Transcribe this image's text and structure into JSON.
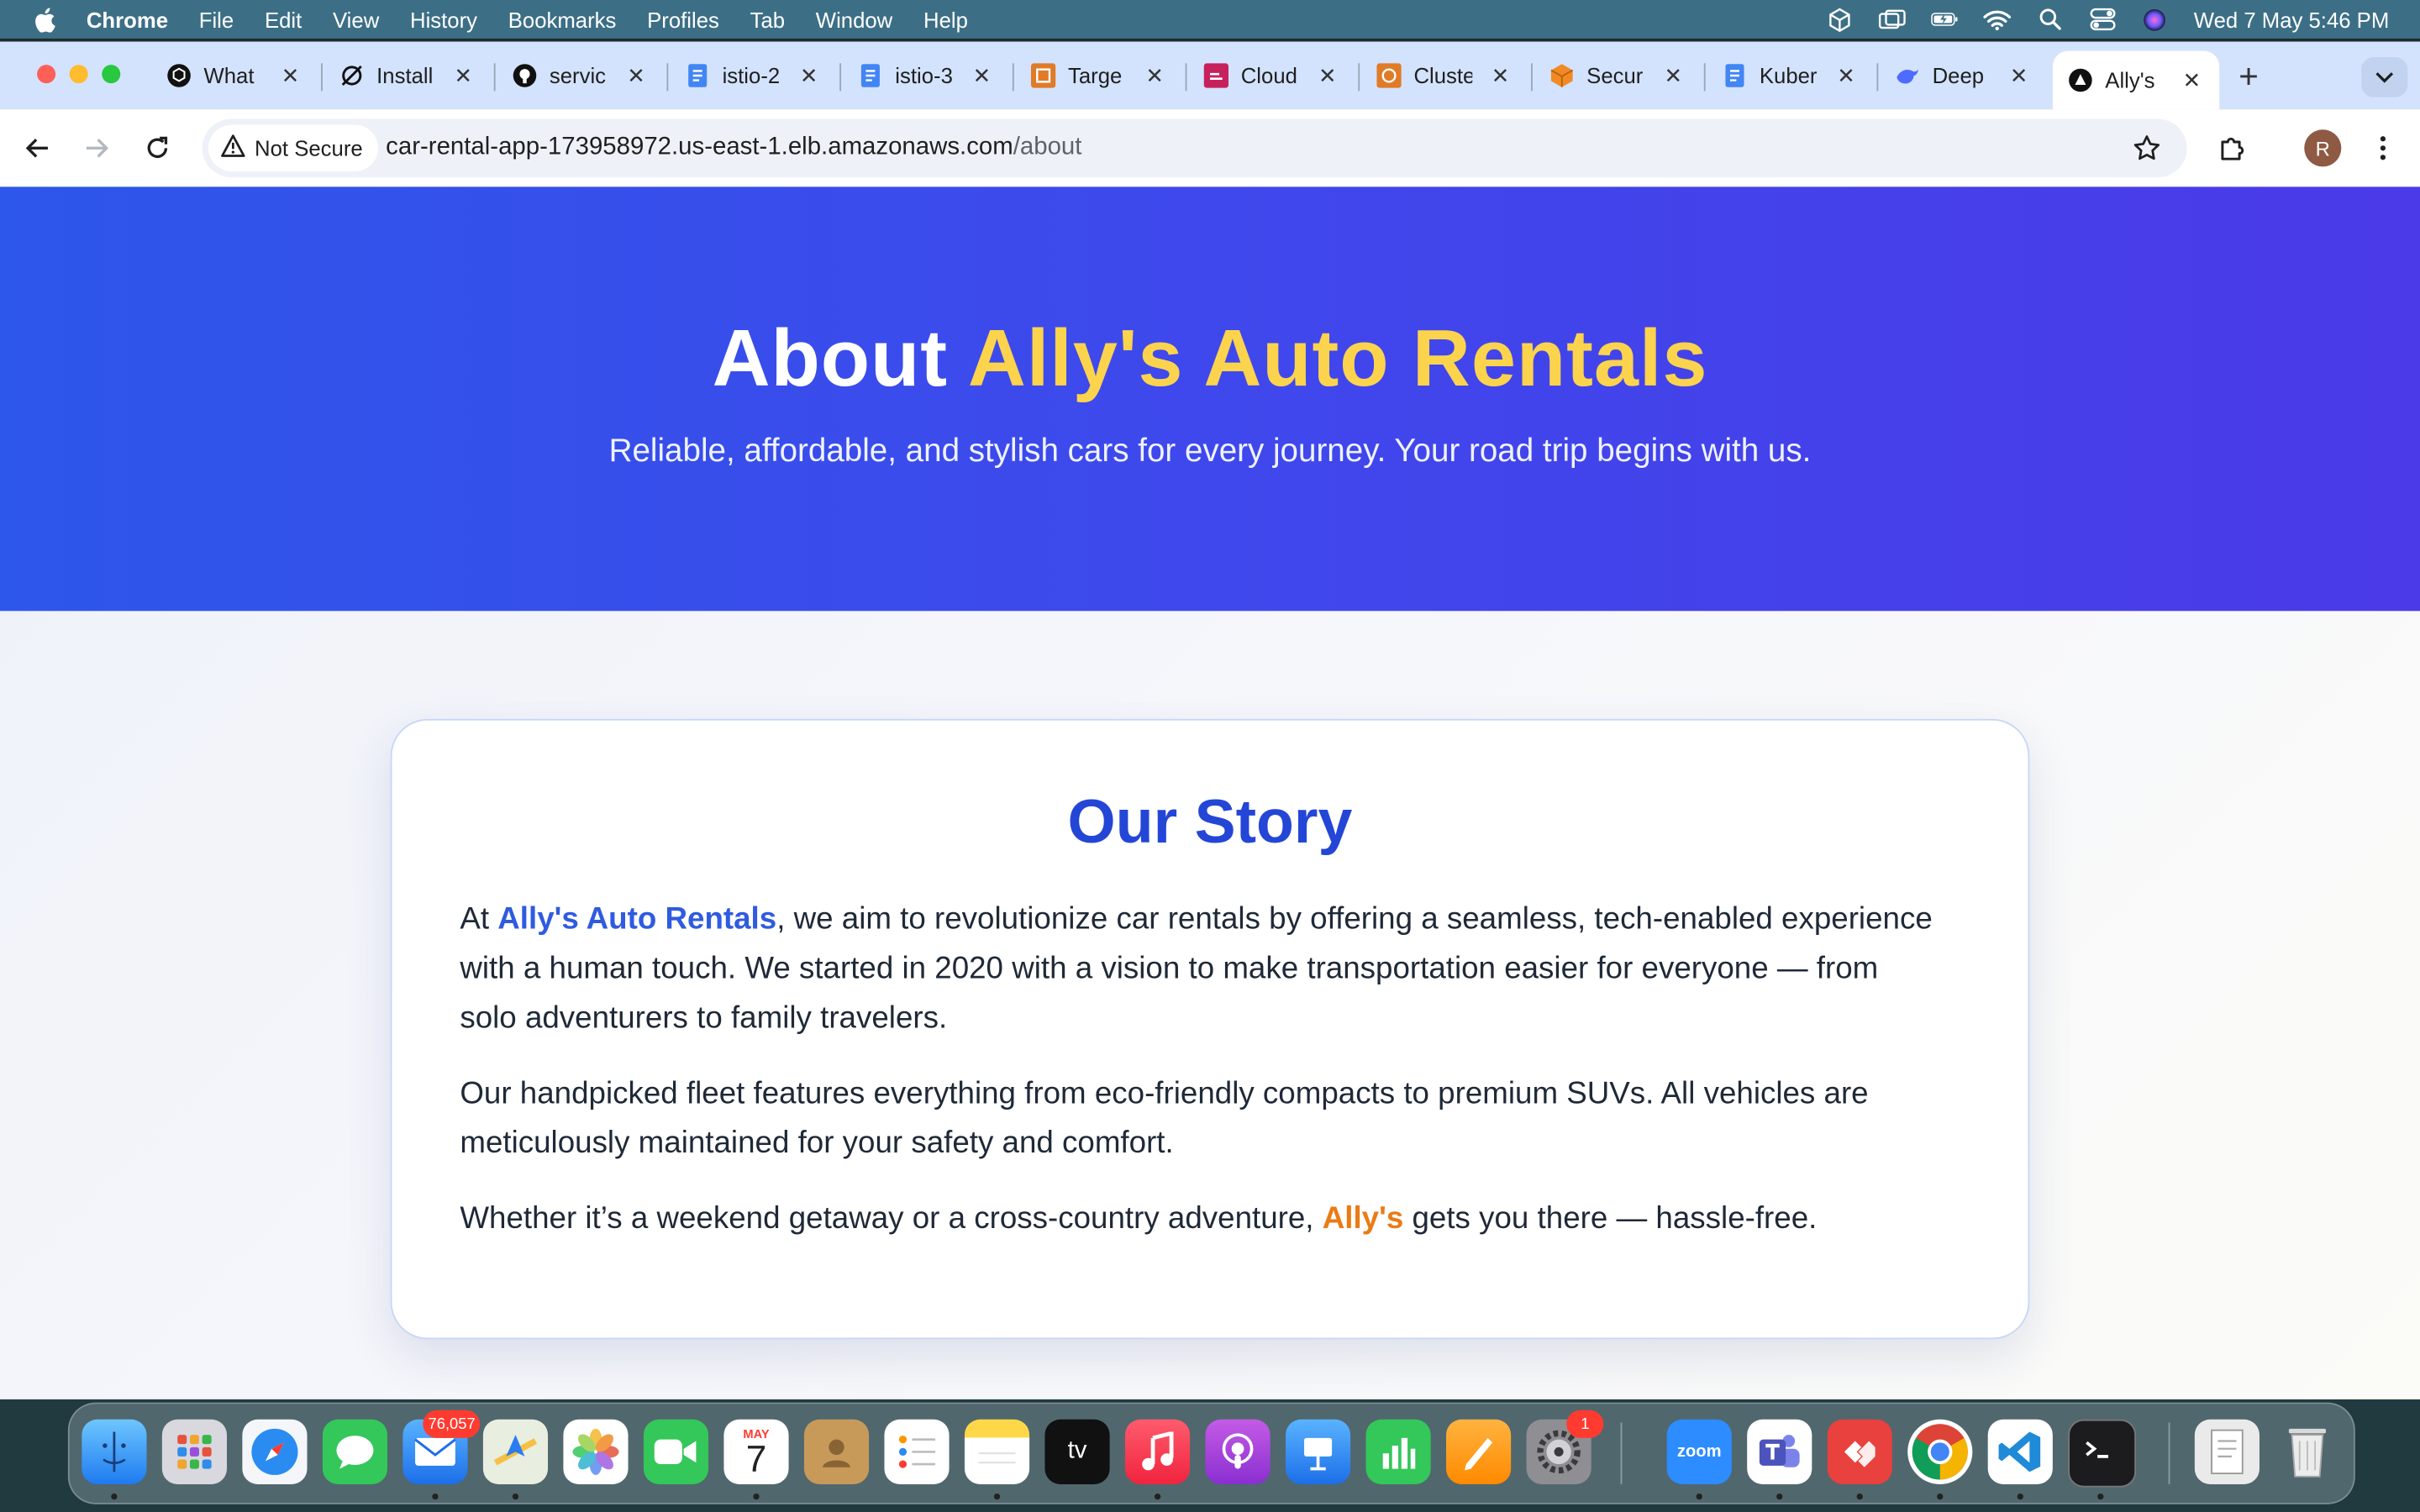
{
  "menubar": {
    "app_name": "Chrome",
    "menus": [
      "File",
      "Edit",
      "View",
      "History",
      "Bookmarks",
      "Profiles",
      "Tab",
      "Window",
      "Help"
    ],
    "clock": "Wed 7 May  5:46 PM"
  },
  "tabs": [
    {
      "title": "What",
      "icon": "openai-icon"
    },
    {
      "title": "Install",
      "icon": "link-icon"
    },
    {
      "title": "servic",
      "icon": "github-icon"
    },
    {
      "title": "istio-2",
      "icon": "docs-icon"
    },
    {
      "title": "istio-3",
      "icon": "docs-icon"
    },
    {
      "title": "Targe",
      "icon": "aws-icon"
    },
    {
      "title": "Cloud",
      "icon": "aws-cloud-icon"
    },
    {
      "title": "Cluste",
      "icon": "aws-icon"
    },
    {
      "title": "Secur",
      "icon": "cube-icon"
    },
    {
      "title": "Kuber",
      "icon": "docs-icon"
    },
    {
      "title": "Deep",
      "icon": "deepseek-icon"
    },
    {
      "title": "Ally's",
      "icon": "triangle-icon",
      "active": true
    }
  ],
  "addressbar": {
    "security_label": "Not Secure",
    "url_host": "car-rental-app-173958972.us-east-1.elb.amazonaws.com",
    "url_path": "/about"
  },
  "profile_initial": "R",
  "hero": {
    "title_prefix": "About ",
    "title_brand": "Ally's Auto Rentals",
    "subtitle": "Reliable, affordable, and stylish cars for every journey. Your road trip begins with us."
  },
  "story": {
    "heading": "Our Story",
    "p1_before": "At ",
    "p1_brand": "Ally's Auto Rentals",
    "p1_after": ", we aim to revolutionize car rentals by offering a seamless, tech-enabled experience with a human touch. We started in 2020 with a vision to make transportation easier for everyone — from solo adventurers to family travelers.",
    "p2": "Our handpicked fleet features everything from eco-friendly compacts to premium SUVs. All vehicles are meticulously maintained for your safety and comfort.",
    "p3_before": "Whether it’s a weekend getaway or a cross-country adventure, ",
    "p3_brand": "Ally's",
    "p3_after": " gets you there — hassle-free."
  },
  "dock": {
    "mail_badge": "76,057",
    "calendar_month": "MAY",
    "calendar_day": "7",
    "settings_badge": "1",
    "zoom_label": "zoom",
    "tv_label": "tv"
  },
  "colors": {
    "hero_start": "#2d56ea",
    "hero_end": "#4a3ae8",
    "brand_yellow": "#fcd34d",
    "heading_blue": "#2446d6",
    "highlight_blue": "#2f5be0",
    "highlight_orange": "#ea7b14"
  }
}
